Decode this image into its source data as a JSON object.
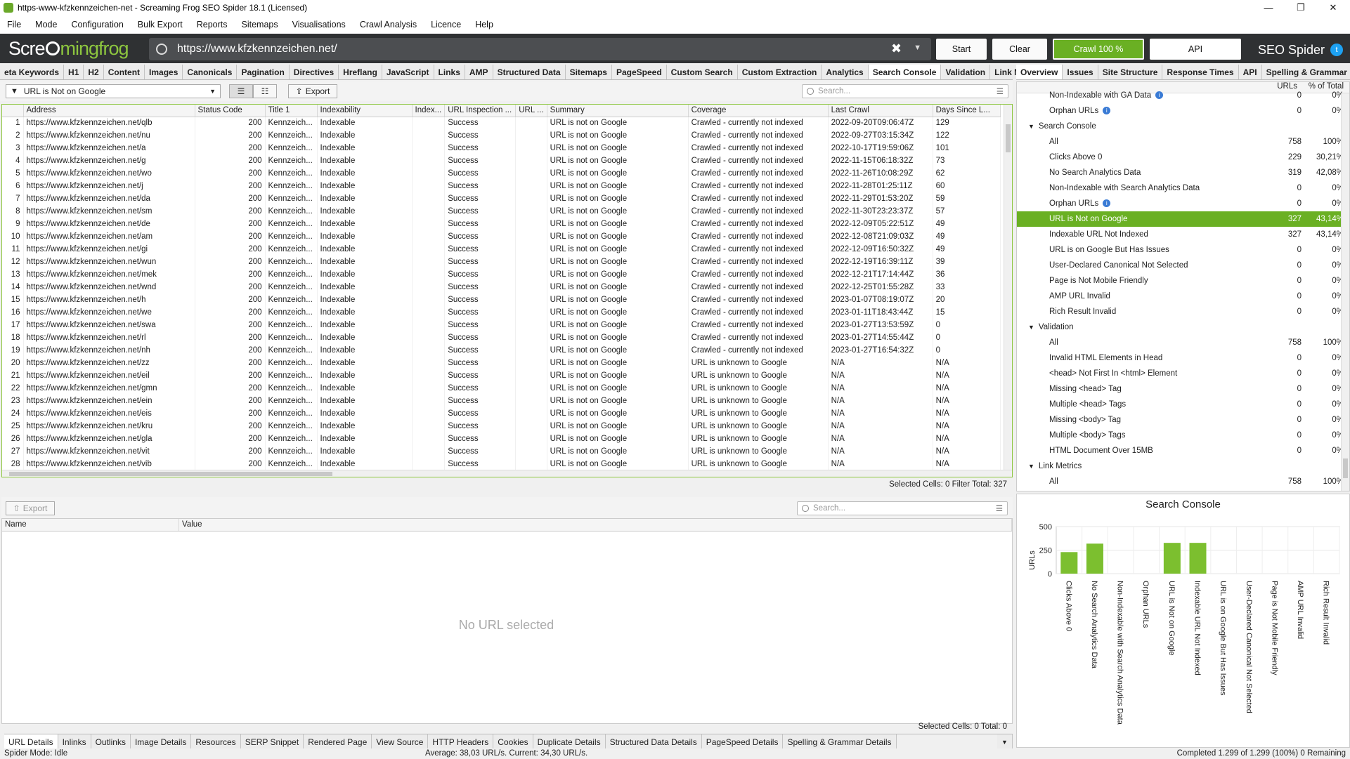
{
  "window": {
    "title": "https-www-kfzkennzeichen-net - Screaming Frog SEO Spider 18.1 (Licensed)"
  },
  "menu": [
    "File",
    "Mode",
    "Configuration",
    "Bulk Export",
    "Reports",
    "Sitemaps",
    "Visualisations",
    "Crawl Analysis",
    "Licence",
    "Help"
  ],
  "toolbar": {
    "logo_a": "Scre",
    "logo_b": "mingfrog",
    "url": "https://www.kfzkennzeichen.net/",
    "start": "Start",
    "clear": "Clear",
    "crawl": "Crawl 100 %",
    "api": "API",
    "brand": "SEO Spider"
  },
  "main_tabs": [
    "eta Keywords",
    "H1",
    "H2",
    "Content",
    "Images",
    "Canonicals",
    "Pagination",
    "Directives",
    "Hreflang",
    "JavaScript",
    "Links",
    "AMP",
    "Structured Data",
    "Sitemaps",
    "PageSpeed",
    "Custom Search",
    "Custom Extraction",
    "Analytics",
    "Search Console",
    "Validation",
    "Link Metrics"
  ],
  "active_main_tab": "Search Console",
  "right_tabs": [
    "Overview",
    "Issues",
    "Site Structure",
    "Response Times",
    "API",
    "Spelling & Grammar"
  ],
  "filter": {
    "value": "URL is Not on Google",
    "export": "Export",
    "search_placeholder": "Search..."
  },
  "columns": [
    "Address",
    "Status Code",
    "Title 1",
    "Indexability",
    "Index...",
    "URL Inspection ...",
    "URL ...",
    "Summary",
    "Coverage",
    "Last Crawl",
    "Days Since L..."
  ],
  "rows": [
    [
      "1",
      "https://www.kfzkennzeichen.net/qlb",
      "200",
      "Kennzeich...",
      "Indexable",
      "",
      "Success",
      "",
      "URL is not on Google",
      "Crawled - currently not indexed",
      "2022-09-20T09:06:47Z",
      "129"
    ],
    [
      "2",
      "https://www.kfzkennzeichen.net/nu",
      "200",
      "Kennzeich...",
      "Indexable",
      "",
      "Success",
      "",
      "URL is not on Google",
      "Crawled - currently not indexed",
      "2022-09-27T03:15:34Z",
      "122"
    ],
    [
      "3",
      "https://www.kfzkennzeichen.net/a",
      "200",
      "Kennzeich...",
      "Indexable",
      "",
      "Success",
      "",
      "URL is not on Google",
      "Crawled - currently not indexed",
      "2022-10-17T19:59:06Z",
      "101"
    ],
    [
      "4",
      "https://www.kfzkennzeichen.net/g",
      "200",
      "Kennzeich...",
      "Indexable",
      "",
      "Success",
      "",
      "URL is not on Google",
      "Crawled - currently not indexed",
      "2022-11-15T06:18:32Z",
      "73"
    ],
    [
      "5",
      "https://www.kfzkennzeichen.net/wo",
      "200",
      "Kennzeich...",
      "Indexable",
      "",
      "Success",
      "",
      "URL is not on Google",
      "Crawled - currently not indexed",
      "2022-11-26T10:08:29Z",
      "62"
    ],
    [
      "6",
      "https://www.kfzkennzeichen.net/j",
      "200",
      "Kennzeich...",
      "Indexable",
      "",
      "Success",
      "",
      "URL is not on Google",
      "Crawled - currently not indexed",
      "2022-11-28T01:25:11Z",
      "60"
    ],
    [
      "7",
      "https://www.kfzkennzeichen.net/da",
      "200",
      "Kennzeich...",
      "Indexable",
      "",
      "Success",
      "",
      "URL is not on Google",
      "Crawled - currently not indexed",
      "2022-11-29T01:53:20Z",
      "59"
    ],
    [
      "8",
      "https://www.kfzkennzeichen.net/sm",
      "200",
      "Kennzeich...",
      "Indexable",
      "",
      "Success",
      "",
      "URL is not on Google",
      "Crawled - currently not indexed",
      "2022-11-30T23:23:37Z",
      "57"
    ],
    [
      "9",
      "https://www.kfzkennzeichen.net/de",
      "200",
      "Kennzeich...",
      "Indexable",
      "",
      "Success",
      "",
      "URL is not on Google",
      "Crawled - currently not indexed",
      "2022-12-09T05:22:51Z",
      "49"
    ],
    [
      "10",
      "https://www.kfzkennzeichen.net/am",
      "200",
      "Kennzeich...",
      "Indexable",
      "",
      "Success",
      "",
      "URL is not on Google",
      "Crawled - currently not indexed",
      "2022-12-08T21:09:03Z",
      "49"
    ],
    [
      "11",
      "https://www.kfzkennzeichen.net/gi",
      "200",
      "Kennzeich...",
      "Indexable",
      "",
      "Success",
      "",
      "URL is not on Google",
      "Crawled - currently not indexed",
      "2022-12-09T16:50:32Z",
      "49"
    ],
    [
      "12",
      "https://www.kfzkennzeichen.net/wun",
      "200",
      "Kennzeich...",
      "Indexable",
      "",
      "Success",
      "",
      "URL is not on Google",
      "Crawled - currently not indexed",
      "2022-12-19T16:39:11Z",
      "39"
    ],
    [
      "13",
      "https://www.kfzkennzeichen.net/mek",
      "200",
      "Kennzeich...",
      "Indexable",
      "",
      "Success",
      "",
      "URL is not on Google",
      "Crawled - currently not indexed",
      "2022-12-21T17:14:44Z",
      "36"
    ],
    [
      "14",
      "https://www.kfzkennzeichen.net/wnd",
      "200",
      "Kennzeich...",
      "Indexable",
      "",
      "Success",
      "",
      "URL is not on Google",
      "Crawled - currently not indexed",
      "2022-12-25T01:55:28Z",
      "33"
    ],
    [
      "15",
      "https://www.kfzkennzeichen.net/h",
      "200",
      "Kennzeich...",
      "Indexable",
      "",
      "Success",
      "",
      "URL is not on Google",
      "Crawled - currently not indexed",
      "2023-01-07T08:19:07Z",
      "20"
    ],
    [
      "16",
      "https://www.kfzkennzeichen.net/we",
      "200",
      "Kennzeich...",
      "Indexable",
      "",
      "Success",
      "",
      "URL is not on Google",
      "Crawled - currently not indexed",
      "2023-01-11T18:43:44Z",
      "15"
    ],
    [
      "17",
      "https://www.kfzkennzeichen.net/swa",
      "200",
      "Kennzeich...",
      "Indexable",
      "",
      "Success",
      "",
      "URL is not on Google",
      "Crawled - currently not indexed",
      "2023-01-27T13:53:59Z",
      "0"
    ],
    [
      "18",
      "https://www.kfzkennzeichen.net/rl",
      "200",
      "Kennzeich...",
      "Indexable",
      "",
      "Success",
      "",
      "URL is not on Google",
      "Crawled - currently not indexed",
      "2023-01-27T14:55:44Z",
      "0"
    ],
    [
      "19",
      "https://www.kfzkennzeichen.net/nh",
      "200",
      "Kennzeich...",
      "Indexable",
      "",
      "Success",
      "",
      "URL is not on Google",
      "Crawled - currently not indexed",
      "2023-01-27T16:54:32Z",
      "0"
    ],
    [
      "20",
      "https://www.kfzkennzeichen.net/zz",
      "200",
      "Kennzeich...",
      "Indexable",
      "",
      "Success",
      "",
      "URL is not on Google",
      "URL is unknown to Google",
      "N/A",
      "N/A"
    ],
    [
      "21",
      "https://www.kfzkennzeichen.net/eil",
      "200",
      "Kennzeich...",
      "Indexable",
      "",
      "Success",
      "",
      "URL is not on Google",
      "URL is unknown to Google",
      "N/A",
      "N/A"
    ],
    [
      "22",
      "https://www.kfzkennzeichen.net/gmn",
      "200",
      "Kennzeich...",
      "Indexable",
      "",
      "Success",
      "",
      "URL is not on Google",
      "URL is unknown to Google",
      "N/A",
      "N/A"
    ],
    [
      "23",
      "https://www.kfzkennzeichen.net/ein",
      "200",
      "Kennzeich...",
      "Indexable",
      "",
      "Success",
      "",
      "URL is not on Google",
      "URL is unknown to Google",
      "N/A",
      "N/A"
    ],
    [
      "24",
      "https://www.kfzkennzeichen.net/eis",
      "200",
      "Kennzeich...",
      "Indexable",
      "",
      "Success",
      "",
      "URL is not on Google",
      "URL is unknown to Google",
      "N/A",
      "N/A"
    ],
    [
      "25",
      "https://www.kfzkennzeichen.net/kru",
      "200",
      "Kennzeich...",
      "Indexable",
      "",
      "Success",
      "",
      "URL is not on Google",
      "URL is unknown to Google",
      "N/A",
      "N/A"
    ],
    [
      "26",
      "https://www.kfzkennzeichen.net/gla",
      "200",
      "Kennzeich...",
      "Indexable",
      "",
      "Success",
      "",
      "URL is not on Google",
      "URL is unknown to Google",
      "N/A",
      "N/A"
    ],
    [
      "27",
      "https://www.kfzkennzeichen.net/vit",
      "200",
      "Kennzeich...",
      "Indexable",
      "",
      "Success",
      "",
      "URL is not on Google",
      "URL is unknown to Google",
      "N/A",
      "N/A"
    ],
    [
      "28",
      "https://www.kfzkennzeichen.net/vib",
      "200",
      "Kennzeich...",
      "Indexable",
      "",
      "Success",
      "",
      "URL is not on Google",
      "URL is unknown to Google",
      "N/A",
      "N/A"
    ]
  ],
  "grid_status": "Selected Cells:  0  Filter Total:  327",
  "detail": {
    "export": "Export",
    "search_placeholder": "Search...",
    "col_name": "Name",
    "col_value": "Value",
    "empty": "No URL selected",
    "status": "Selected Cells:  0  Total:  0"
  },
  "bottom_tabs": [
    "URL Details",
    "Inlinks",
    "Outlinks",
    "Image Details",
    "Resources",
    "SERP Snippet",
    "Rendered Page",
    "View Source",
    "HTTP Headers",
    "Cookies",
    "Duplicate Details",
    "Structured Data Details",
    "PageSpeed Details",
    "Spelling & Grammar Details"
  ],
  "statusbar": {
    "mode": "Spider Mode: Idle",
    "speed": "Average: 38,03 URL/s. Current: 34,30 URL/s.",
    "completed": "Completed 1.299 of 1.299 (100%) 0 Remaining"
  },
  "overview": {
    "col_urls": "URLs",
    "col_pct": "% of Total",
    "rows": [
      {
        "label": "Non-Indexable with GA Data",
        "urls": "0",
        "pct": "0%",
        "indent": 2,
        "info": true,
        "partial": true
      },
      {
        "label": "Orphan URLs",
        "urls": "0",
        "pct": "0%",
        "indent": 2,
        "info": true
      },
      {
        "label": "Search Console",
        "urls": "",
        "pct": "",
        "indent": 1,
        "section": true
      },
      {
        "label": "All",
        "urls": "758",
        "pct": "100%",
        "indent": 2
      },
      {
        "label": "Clicks Above 0",
        "urls": "229",
        "pct": "30,21%",
        "indent": 2
      },
      {
        "label": "No Search Analytics Data",
        "urls": "319",
        "pct": "42,08%",
        "indent": 2
      },
      {
        "label": "Non-Indexable with Search Analytics Data",
        "urls": "0",
        "pct": "0%",
        "indent": 2
      },
      {
        "label": "Orphan URLs",
        "urls": "0",
        "pct": "0%",
        "indent": 2,
        "info": true
      },
      {
        "label": "URL is Not on Google",
        "urls": "327",
        "pct": "43,14%",
        "indent": 2,
        "selected": true
      },
      {
        "label": "Indexable URL Not Indexed",
        "urls": "327",
        "pct": "43,14%",
        "indent": 2
      },
      {
        "label": "URL is on Google But Has Issues",
        "urls": "0",
        "pct": "0%",
        "indent": 2
      },
      {
        "label": "User-Declared Canonical Not Selected",
        "urls": "0",
        "pct": "0%",
        "indent": 2
      },
      {
        "label": "Page is Not Mobile Friendly",
        "urls": "0",
        "pct": "0%",
        "indent": 2
      },
      {
        "label": "AMP URL Invalid",
        "urls": "0",
        "pct": "0%",
        "indent": 2
      },
      {
        "label": "Rich Result Invalid",
        "urls": "0",
        "pct": "0%",
        "indent": 2
      },
      {
        "label": "Validation",
        "urls": "",
        "pct": "",
        "indent": 1,
        "section": true
      },
      {
        "label": "All",
        "urls": "758",
        "pct": "100%",
        "indent": 2
      },
      {
        "label": "Invalid HTML Elements in Head",
        "urls": "0",
        "pct": "0%",
        "indent": 2
      },
      {
        "label": "<head> Not First In <html> Element",
        "urls": "0",
        "pct": "0%",
        "indent": 2
      },
      {
        "label": "Missing <head> Tag",
        "urls": "0",
        "pct": "0%",
        "indent": 2
      },
      {
        "label": "Multiple <head> Tags",
        "urls": "0",
        "pct": "0%",
        "indent": 2
      },
      {
        "label": "Missing <body> Tag",
        "urls": "0",
        "pct": "0%",
        "indent": 2
      },
      {
        "label": "Multiple <body> Tags",
        "urls": "0",
        "pct": "0%",
        "indent": 2
      },
      {
        "label": "HTML Document Over 15MB",
        "urls": "0",
        "pct": "0%",
        "indent": 2
      },
      {
        "label": "Link Metrics",
        "urls": "",
        "pct": "",
        "indent": 1,
        "section": true
      },
      {
        "label": "All",
        "urls": "758",
        "pct": "100%",
        "indent": 2
      }
    ]
  },
  "colors": {
    "accent": "#6ab023",
    "topbar": "#2f3133",
    "bar": "#7cbf2f"
  },
  "chart_data": {
    "type": "bar",
    "title": "Search Console",
    "ylabel": "URLs",
    "ylim": [
      0,
      500
    ],
    "yticks": [
      0,
      250,
      500
    ],
    "categories": [
      "Clicks Above 0",
      "No Search Analytics Data",
      "Non-Indexable with Search Analytics Data",
      "Orphan URLs",
      "URL is Not on Google",
      "Indexable URL Not Indexed",
      "URL is on Google But Has Issues",
      "User-Declared Canonical Not Selected",
      "Page is Not Mobile Friendly",
      "AMP URL Invalid",
      "Rich Result Invalid"
    ],
    "values": [
      229,
      319,
      0,
      0,
      327,
      327,
      0,
      0,
      0,
      0,
      0
    ]
  }
}
